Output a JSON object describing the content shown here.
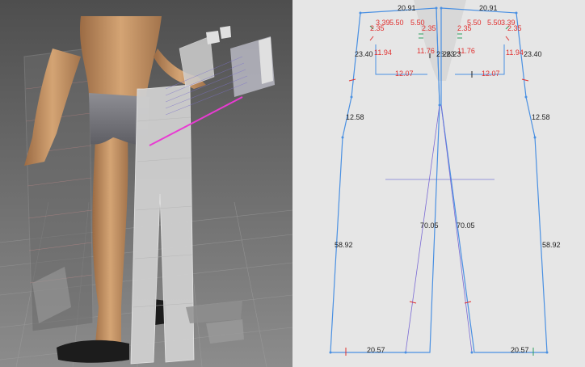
{
  "colors": {
    "outline": "#4a90e2",
    "measure_red": "#e0302f",
    "measure_black": "#222222",
    "viewport_bg_top": "#5a5a5a",
    "viewport_bg_bottom": "#8a8a8a",
    "editor_bg": "#e6e6e6",
    "highlight_magenta": "#e83bd2"
  },
  "pattern": {
    "left_panel": {
      "waist": "20.91",
      "dart_a_left": "3.39",
      "dart_a_right": "5.50",
      "dart_b_left": "5.50",
      "pocket_left": "2.35",
      "pocket_right": "2.35",
      "side_upper": "23.40",
      "pocket_depth_left": "11.94",
      "pocket_depth_right": "11.76",
      "pocket_width": "12.07",
      "hip": "12.58",
      "crotch_label": "26.23",
      "inseam": "70.05",
      "outseam": "58.92",
      "hem": "20.57"
    },
    "right_panel": {
      "waist": "20.91",
      "dart_a_left": "5.50",
      "dart_a_right": "5.50",
      "dart_b_right": "3.39",
      "pocket_left": "2.35",
      "pocket_right": "2.35",
      "side_upper": "23.40",
      "pocket_depth_left": "11.76",
      "pocket_depth_right": "11.94",
      "pocket_width": "12.07",
      "hip": "12.58",
      "crotch_label": "26.23",
      "inseam": "70.05",
      "outseam": "58.92",
      "hem": "20.57"
    }
  }
}
